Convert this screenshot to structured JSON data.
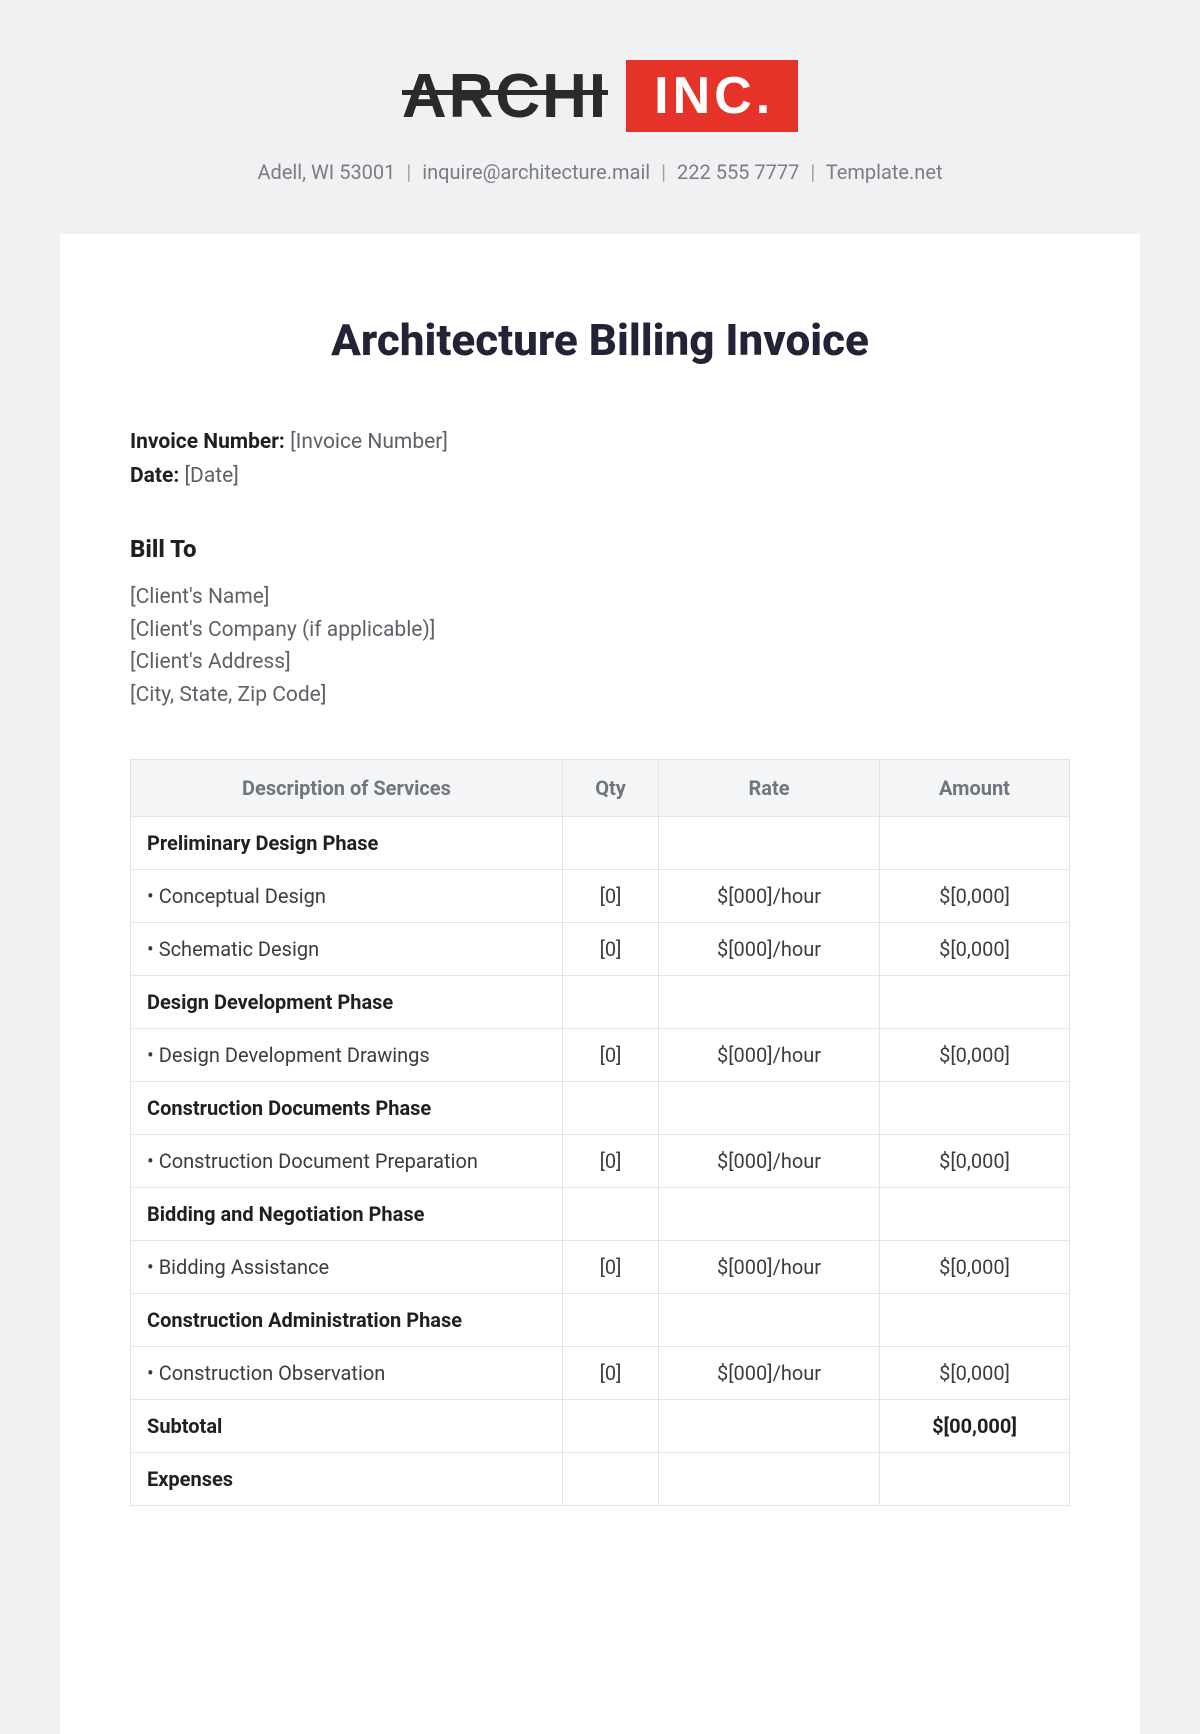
{
  "logo": {
    "word": "ARCHI",
    "badge": "INC."
  },
  "contact": {
    "address": "Adell, WI 53001",
    "email": "inquire@architecture.mail",
    "phone": "222 555 7777",
    "site": "Template.net"
  },
  "title": "Architecture Billing Invoice",
  "meta": {
    "invoice_label": "Invoice Number:",
    "invoice_value": "[Invoice Number]",
    "date_label": "Date:",
    "date_value": "[Date]"
  },
  "billto": {
    "heading": "Bill To",
    "lines": [
      "[Client's Name]",
      "[Client's Company (if applicable)]",
      "[Client's Address]",
      "[City, State, Zip Code]"
    ]
  },
  "table": {
    "headers": {
      "desc": "Description of Services",
      "qty": "Qty",
      "rate": "Rate",
      "amount": "Amount"
    },
    "rows": [
      {
        "type": "phase",
        "desc": "Preliminary Design Phase"
      },
      {
        "type": "item",
        "desc": "• Conceptual Design",
        "qty": "[0]",
        "rate": "$[000]/hour",
        "amount": "$[0,000]"
      },
      {
        "type": "item",
        "desc": "• Schematic Design",
        "qty": "[0]",
        "rate": "$[000]/hour",
        "amount": "$[0,000]"
      },
      {
        "type": "phase",
        "desc": "Design Development Phase"
      },
      {
        "type": "item",
        "desc": "• Design Development Drawings",
        "qty": "[0]",
        "rate": "$[000]/hour",
        "amount": "$[0,000]"
      },
      {
        "type": "phase",
        "desc": "Construction Documents Phase"
      },
      {
        "type": "item",
        "desc": "• Construction Document Preparation",
        "qty": "[0]",
        "rate": "$[000]/hour",
        "amount": "$[0,000]"
      },
      {
        "type": "phase",
        "desc": "Bidding and Negotiation Phase"
      },
      {
        "type": "item",
        "desc": "• Bidding Assistance",
        "qty": "[0]",
        "rate": "$[000]/hour",
        "amount": "$[0,000]"
      },
      {
        "type": "phase",
        "desc": "Construction Administration Phase"
      },
      {
        "type": "item",
        "desc": "• Construction Observation",
        "qty": "[0]",
        "rate": "$[000]/hour",
        "amount": "$[0,000]"
      },
      {
        "type": "subtotal",
        "desc": "Subtotal",
        "amount": "$[00,000]"
      },
      {
        "type": "phase",
        "desc": "Expenses"
      }
    ]
  }
}
